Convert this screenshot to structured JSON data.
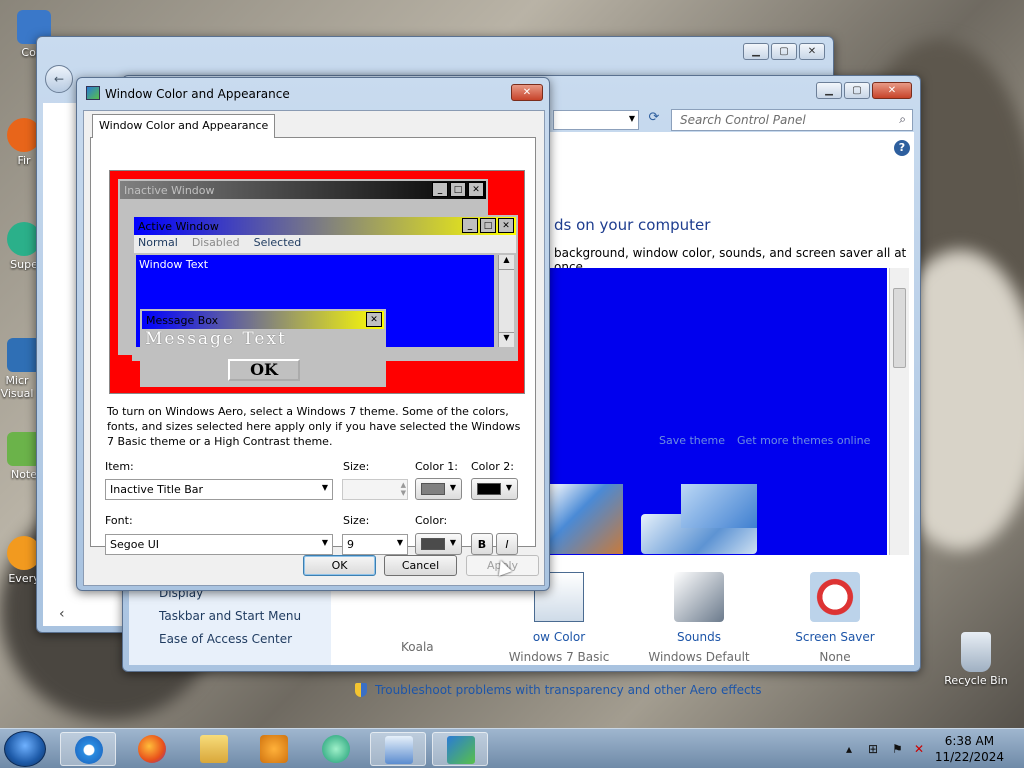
{
  "desktop": {
    "icons": [
      {
        "label": "Com",
        "color": "#3a78c9"
      },
      {
        "label": "Fir",
        "color": "#e8651a"
      },
      {
        "label": "Supe",
        "color": "#2bb08a"
      },
      {
        "label": "Micr Visual",
        "color": "#2f6fb5"
      },
      {
        "label": "Note",
        "color": "#6bb34a"
      },
      {
        "label": "Every",
        "color": "#f29a1f"
      }
    ],
    "recycle_bin": "Recycle Bin"
  },
  "control_panel": {
    "search_placeholder": "Search Control Panel",
    "heading": "ds on your computer",
    "subheading": "background, window color, sounds, and screen saver all at once.",
    "save_theme": "Save theme",
    "get_more_themes": "Get more themes online",
    "left_links": [
      "Display",
      "Taskbar and Start Menu",
      "Ease of Access Center"
    ],
    "bottom_items": [
      {
        "title": "ow Color",
        "sub": "Windows 7 Basic"
      },
      {
        "title": "Sounds",
        "sub": "Windows Default"
      },
      {
        "title": "Screen Saver",
        "sub": "None"
      }
    ],
    "koala": "Koala",
    "troubleshoot": "Troubleshoot problems with transparency and other Aero effects"
  },
  "dialog": {
    "title": "Window Color and Appearance",
    "tab": "Window Color and Appearance",
    "preview": {
      "inactive_window": "Inactive Window",
      "active_window": "Active Window",
      "menu_normal": "Normal",
      "menu_disabled": "Disabled",
      "menu_selected": "Selected",
      "window_text": "Window Text",
      "message_box": "Message Box",
      "message_text": "Message Text",
      "ok": "OK"
    },
    "description": "To turn on Windows Aero, select a Windows 7 theme.  Some of the colors, fonts, and sizes selected here apply only if you have selected the Windows 7 Basic theme or a High Contrast theme.",
    "labels": {
      "item": "Item:",
      "size": "Size:",
      "color1": "Color 1:",
      "color2": "Color 2:",
      "font": "Font:",
      "font_size": "Size:",
      "font_color": "Color:"
    },
    "item_value": "Inactive Title Bar",
    "font_value": "Segoe UI",
    "font_size_value": "9",
    "bold": "B",
    "italic": "I",
    "colors": {
      "color1": "#808080",
      "color2": "#000000",
      "font_color": "#4b4b4b"
    },
    "buttons": {
      "ok": "OK",
      "cancel": "Cancel",
      "apply": "Apply"
    }
  },
  "taskbar": {
    "time": "6:38 AM",
    "date": "11/22/2024"
  }
}
